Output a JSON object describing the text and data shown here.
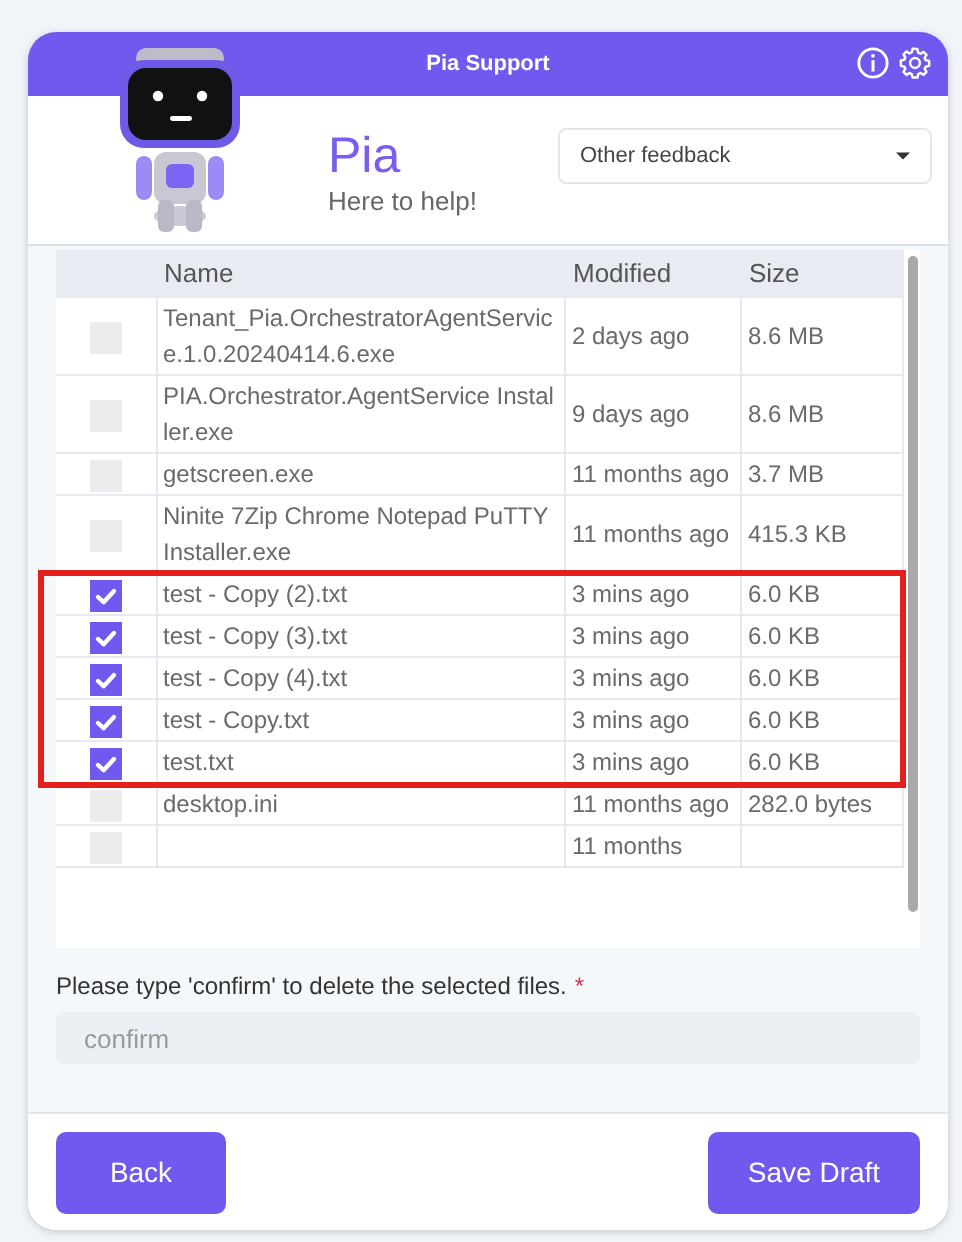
{
  "window": {
    "title": "Pia Support"
  },
  "header": {
    "name": "Pia",
    "tagline": "Here to help!"
  },
  "category_dropdown": {
    "value": "Other feedback"
  },
  "table": {
    "columns": [
      "Name",
      "Modified",
      "Size"
    ],
    "rows": [
      {
        "name": "Tenant_Pia.OrchestratorAgentService.1.0.20240414.6.exe",
        "modified": "2 days ago",
        "size": "8.6 MB",
        "checked": false,
        "highlighted": false
      },
      {
        "name": "PIA.Orchestrator.AgentService Installer.exe",
        "modified": "9 days ago",
        "size": "8.6 MB",
        "checked": false,
        "highlighted": false
      },
      {
        "name": "getscreen.exe",
        "modified": "11 months ago",
        "size": "3.7 MB",
        "checked": false,
        "highlighted": false
      },
      {
        "name": "Ninite 7Zip Chrome Notepad PuTTY Installer.exe",
        "modified": "11 months ago",
        "size": "415.3 KB",
        "checked": false,
        "highlighted": false
      },
      {
        "name": "test - Copy (2).txt",
        "modified": "3 mins ago",
        "size": "6.0 KB",
        "checked": true,
        "highlighted": true
      },
      {
        "name": "test - Copy (3).txt",
        "modified": "3 mins ago",
        "size": "6.0 KB",
        "checked": true,
        "highlighted": true
      },
      {
        "name": "test - Copy (4).txt",
        "modified": "3 mins ago",
        "size": "6.0 KB",
        "checked": true,
        "highlighted": true
      },
      {
        "name": "test - Copy.txt",
        "modified": "3 mins ago",
        "size": "6.0 KB",
        "checked": true,
        "highlighted": true
      },
      {
        "name": "test.txt",
        "modified": "3 mins ago",
        "size": "6.0 KB",
        "checked": true,
        "highlighted": true
      },
      {
        "name": "desktop.ini",
        "modified": "11 months ago",
        "size": "282.0 bytes",
        "checked": false,
        "highlighted": false
      },
      {
        "modified": "11 months",
        "checked": false,
        "highlighted": false
      }
    ]
  },
  "highlight_box": {
    "kind": "outline"
  },
  "confirm_field": {
    "label": "Please type 'confirm' to delete the selected files.",
    "required_marker": "*",
    "placeholder": "confirm"
  },
  "buttons": [
    "Back",
    "Save Draft"
  ]
}
